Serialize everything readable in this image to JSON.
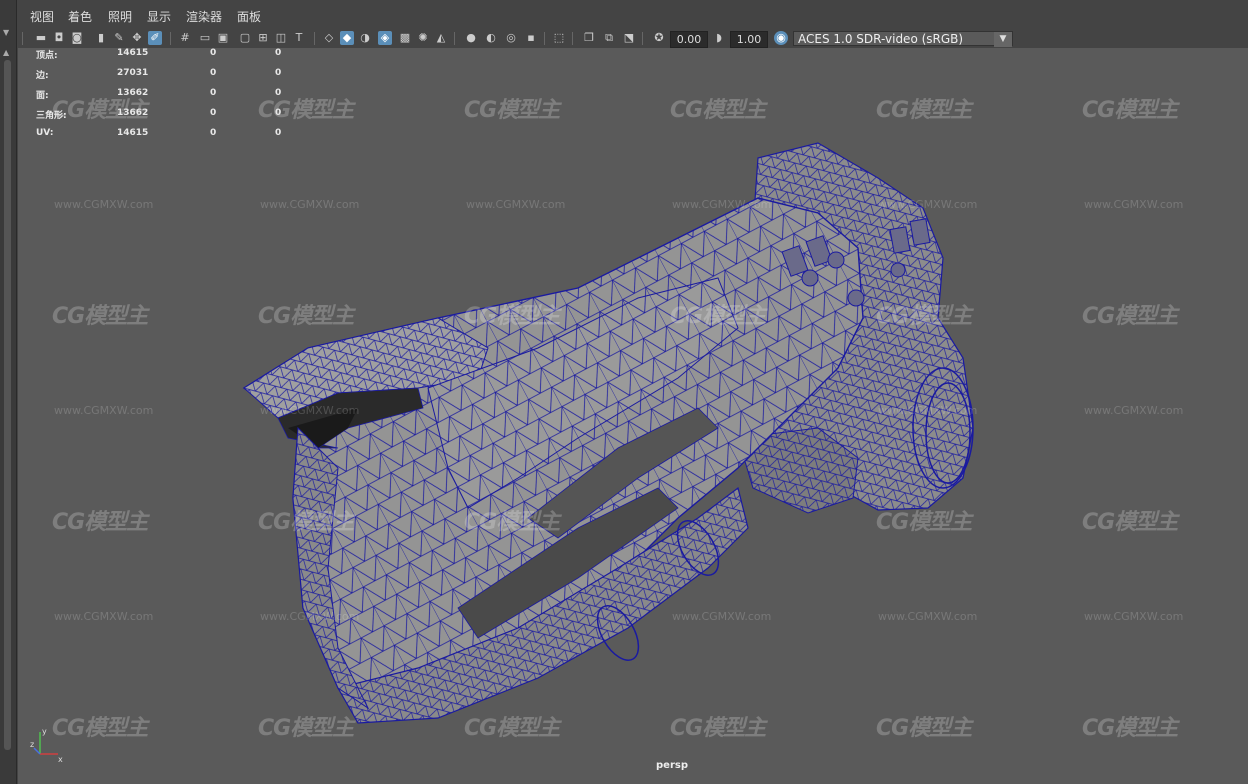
{
  "menu": [
    "视图",
    "着色",
    "照明",
    "显示",
    "渲染器",
    "面板"
  ],
  "toolbar": {
    "exposure_value": "0.00",
    "gamma_value": "1.00",
    "colorspace": "ACES 1.0 SDR-video (sRGB)"
  },
  "hud": {
    "rows": [
      {
        "label": "顶点:",
        "v1": "14615",
        "v2": "0",
        "v3": "0"
      },
      {
        "label": "边:",
        "v1": "27031",
        "v2": "0",
        "v3": "0"
      },
      {
        "label": "面:",
        "v1": "13662",
        "v2": "0",
        "v3": "0"
      },
      {
        "label": "三角形:",
        "v1": "13662",
        "v2": "0",
        "v3": "0"
      },
      {
        "label": "UV:",
        "v1": "14615",
        "v2": "0",
        "v3": "0"
      }
    ]
  },
  "watermark": {
    "logo": "CG模型主",
    "url": "www.CGMXW.com"
  },
  "camera_label": "persp",
  "axis": {
    "x": "x",
    "y": "y",
    "z": "z"
  },
  "colors": {
    "viewport_bg": "#5a5a5a",
    "wire": "#1a1aa0",
    "mesh_fill": "#8a8a8a",
    "active_icon": "#5b8fb9"
  }
}
